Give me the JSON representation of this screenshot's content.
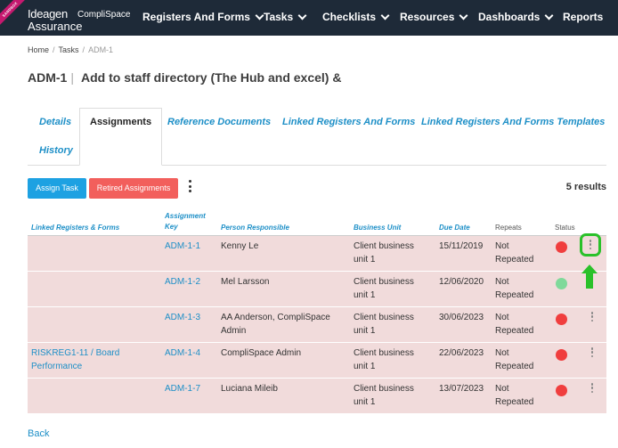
{
  "nav": {
    "sandbox_label": "SANDBOX",
    "logo_brand": "Ideagen",
    "logo_brand2": "CompliSpace",
    "logo_sub": "Assurance",
    "items": [
      {
        "label": "Registers And Forms"
      },
      {
        "label": "Tasks"
      },
      {
        "label": "Checklists"
      },
      {
        "label": "Resources"
      },
      {
        "label": "Dashboards"
      },
      {
        "label": "Reports"
      }
    ]
  },
  "breadcrumb": {
    "home": "Home",
    "tasks": "Tasks",
    "current": "ADM-1"
  },
  "page": {
    "id": "ADM-1",
    "separator": "|",
    "title": "Add to staff directory (The Hub and excel) &"
  },
  "tabs": [
    {
      "label": "Details"
    },
    {
      "label": "Assignments"
    },
    {
      "label": "Reference Documents"
    },
    {
      "label": "Linked Registers And Forms"
    },
    {
      "label": "Linked Registers And Forms Templates"
    },
    {
      "label": "History"
    }
  ],
  "toolbar": {
    "assign_label": "Assign Task",
    "retired_label": "Retired Assignments",
    "results": "5 results"
  },
  "table": {
    "headers": {
      "linked": "Linked Registers & Forms",
      "key_line1": "Assignment",
      "key_line2": "Key",
      "person": "Person Responsible",
      "unit": "Business Unit",
      "due": "Due Date",
      "repeats": "Repeats",
      "status": "Status"
    },
    "rows": [
      {
        "linked1": "",
        "linked2": "",
        "key": "ADM-1-1",
        "person1": "Kenny Le",
        "person2": "",
        "unit1": "Client business",
        "unit2": "unit 1",
        "due": "15/11/2019",
        "rep1": "Not",
        "rep2": "Repeated",
        "status_color": "#f03e3e"
      },
      {
        "linked1": "",
        "linked2": "",
        "key": "ADM-1-2",
        "person1": "Mel Larsson",
        "person2": "",
        "unit1": "Client business",
        "unit2": "unit 1",
        "due": "12/06/2020",
        "rep1": "Not",
        "rep2": "Repeated",
        "status_color": "#7fd99a"
      },
      {
        "linked1": "",
        "linked2": "",
        "key": "ADM-1-3",
        "person1": "AA Anderson, CompliSpace",
        "person2": "Admin",
        "unit1": "Client business",
        "unit2": "unit 1",
        "due": "30/06/2023",
        "rep1": "Not",
        "rep2": "Repeated",
        "status_color": "#f03e3e"
      },
      {
        "linked1": "RISKREG1-11 / Board",
        "linked2": "Performance",
        "key": "ADM-1-4",
        "person1": "CompliSpace Admin",
        "person2": "",
        "unit1": "Client business",
        "unit2": "unit 1",
        "due": "22/06/2023",
        "rep1": "Not",
        "rep2": "Repeated",
        "status_color": "#f03e3e"
      },
      {
        "linked1": "",
        "linked2": "",
        "key": "ADM-1-7",
        "person1": "Luciana Mileib",
        "person2": "",
        "unit1": "Client business",
        "unit2": "unit 1",
        "due": "13/07/2023",
        "rep1": "Not",
        "rep2": "Repeated",
        "status_color": "#f03e3e"
      }
    ]
  },
  "back_label": "Back"
}
